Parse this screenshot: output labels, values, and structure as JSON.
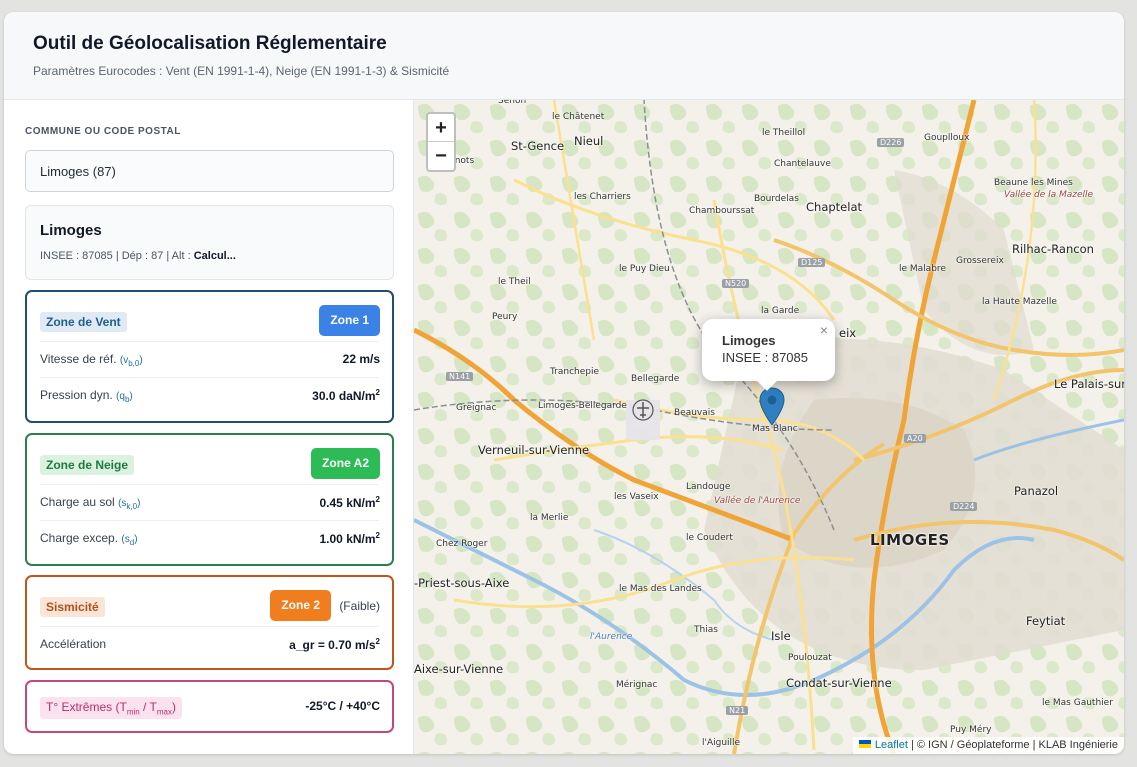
{
  "header": {
    "title": "Outil de Géolocalisation Réglementaire",
    "subtitle": "Paramètres Eurocodes : Vent (EN 1991-1-4), Neige (EN 1991-1-3) & Sismicité"
  },
  "search": {
    "label": "COMMUNE OU CODE POSTAL",
    "value": "Limoges (87)"
  },
  "commune": {
    "name": "Limoges",
    "meta": "INSEE : 87085 | Dép : 87 | Alt : ",
    "alt_value": "Calcul..."
  },
  "wind": {
    "title": "Zone de Vent",
    "zone": "Zone 1",
    "speed_label": "Vitesse de réf.",
    "speed_sym": "v",
    "speed_sub": "b,0",
    "speed_value": "22 m/s",
    "pressure_label": "Pression dyn.",
    "pressure_sym": "q",
    "pressure_sub": "b",
    "pressure_value": "30.0 daN/m",
    "pressure_exp": "2"
  },
  "snow": {
    "title": "Zone de Neige",
    "zone": "Zone A2",
    "ground_label": "Charge au sol",
    "ground_sym": "s",
    "ground_sub": "k,0",
    "ground_value": "0.45 kN/m",
    "ground_exp": "2",
    "excep_label": "Charge excep.",
    "excep_sym": "s",
    "excep_sub": "d",
    "excep_value": "1.00 kN/m",
    "excep_exp": "2"
  },
  "seismic": {
    "title": "Sismicité",
    "zone": "Zone 2",
    "level": "(Faible)",
    "accel_label": "Accélération",
    "accel_value": "a_gr = 0.70 m/s",
    "accel_exp": "2"
  },
  "temperature": {
    "title_prefix": "T° Extrêmes (T",
    "min_sub": "min",
    "separator": " / T",
    "max_sub": "max",
    "title_suffix": ")",
    "value": "-25°C / +40°C"
  },
  "map": {
    "zoom_in": "+",
    "zoom_out": "−",
    "popup": {
      "title": "Limoges",
      "insee": "INSEE : 87085",
      "close": "×"
    },
    "marker_color": "#2f7fc1",
    "attribution": {
      "link": "Leaflet",
      "text": " | © IGN / Géoplateforme | KLAB Ingénierie"
    },
    "places": [
      {
        "name": "Senon",
        "cls": ""
      },
      {
        "name": "le Châtenet",
        "cls": ""
      },
      {
        "name": "le Theillol",
        "cls": ""
      },
      {
        "name": "Gouplloux",
        "cls": ""
      },
      {
        "name": "St-Gence",
        "cls": "town"
      },
      {
        "name": "Nieul",
        "cls": "town"
      },
      {
        "name": "sjanots",
        "cls": ""
      },
      {
        "name": "Chantelauve",
        "cls": ""
      },
      {
        "name": "Beaune les Mines",
        "cls": ""
      },
      {
        "name": "Vallée de la Mazelle",
        "cls": "nature"
      },
      {
        "name": "les Charriers",
        "cls": ""
      },
      {
        "name": "Bourdelas",
        "cls": ""
      },
      {
        "name": "Chambourssat",
        "cls": ""
      },
      {
        "name": "Chaptelat",
        "cls": "town"
      },
      {
        "name": "Rilhac-Rancon",
        "cls": "town"
      },
      {
        "name": "le Puy Dieu",
        "cls": ""
      },
      {
        "name": "le Malabre",
        "cls": ""
      },
      {
        "name": "Grossereix",
        "cls": ""
      },
      {
        "name": "le Theil",
        "cls": ""
      },
      {
        "name": "la Haute Mazelle",
        "cls": ""
      },
      {
        "name": "la Garde",
        "cls": ""
      },
      {
        "name": "Peury",
        "cls": ""
      },
      {
        "name": "eix",
        "cls": "town"
      },
      {
        "name": "Tranchepie",
        "cls": ""
      },
      {
        "name": "Bellegarde",
        "cls": ""
      },
      {
        "name": "Le Palais-sur-",
        "cls": "town"
      },
      {
        "name": "Greignac",
        "cls": ""
      },
      {
        "name": "Limoges-Bellegarde",
        "cls": ""
      },
      {
        "name": "Beauvais",
        "cls": ""
      },
      {
        "name": "Mas Blanc",
        "cls": ""
      },
      {
        "name": "Verneuil-sur-Vienne",
        "cls": "town"
      },
      {
        "name": "Landouge",
        "cls": ""
      },
      {
        "name": "Panazol",
        "cls": "town"
      },
      {
        "name": "les Vaseix",
        "cls": ""
      },
      {
        "name": "Vallée de l'Aurence",
        "cls": "nature"
      },
      {
        "name": "la Merlie",
        "cls": ""
      },
      {
        "name": "Chez Roger",
        "cls": ""
      },
      {
        "name": "le Coudert",
        "cls": ""
      },
      {
        "name": "LIMOGES",
        "cls": "city"
      },
      {
        "name": "-Priest-sous-Aixe",
        "cls": "town"
      },
      {
        "name": "le Mas des Landes",
        "cls": ""
      },
      {
        "name": "Feytiat",
        "cls": "town"
      },
      {
        "name": "l'Aurence",
        "cls": "river"
      },
      {
        "name": "Thias",
        "cls": ""
      },
      {
        "name": "Isle",
        "cls": "town"
      },
      {
        "name": "Poulouzat",
        "cls": ""
      },
      {
        "name": "Aixe-sur-Vienne",
        "cls": "town"
      },
      {
        "name": "Condat-sur-Vienne",
        "cls": "town"
      },
      {
        "name": "Mérignac",
        "cls": ""
      },
      {
        "name": "le Mas Gauthier",
        "cls": ""
      },
      {
        "name": "Puy Méry",
        "cls": ""
      },
      {
        "name": "l'Aiguille",
        "cls": ""
      }
    ],
    "roads": [
      "D226",
      "N520",
      "D125",
      "N141",
      "A20",
      "D224",
      "N21"
    ]
  }
}
